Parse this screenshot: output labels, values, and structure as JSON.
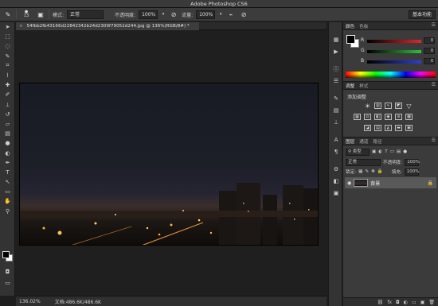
{
  "window": {
    "title": "Adobe Photoshop CS6"
  },
  "options_bar": {
    "mode_label": "模式:",
    "mode_value": "正常",
    "opacity_label": "不透明度:",
    "opacity_value": "100%",
    "flow_label": "流量:",
    "flow_value": "100%",
    "brush_size": "13",
    "workspace_label": "基本功能"
  },
  "document": {
    "tab_title": "54fbb2fb43166d22842342b24d2309f79052d244.jpg @ 136%(RGB/8#) *",
    "close_glyph": "×"
  },
  "status_bar": {
    "zoom": "136.02%",
    "doc_size": "文档:486.6K/486.6K"
  },
  "tools": [
    {
      "name": "move-tool-icon",
      "glyph": "➤"
    },
    {
      "name": "marquee-tool-icon",
      "glyph": "⬚"
    },
    {
      "name": "lasso-tool-icon",
      "glyph": "◌"
    },
    {
      "name": "quick-select-tool-icon",
      "glyph": "✎"
    },
    {
      "name": "crop-tool-icon",
      "glyph": "⌗"
    },
    {
      "name": "eyedropper-tool-icon",
      "glyph": "⌇"
    },
    {
      "name": "healing-brush-tool-icon",
      "glyph": "✚"
    },
    {
      "name": "brush-tool-icon",
      "glyph": "✐"
    },
    {
      "name": "clone-stamp-tool-icon",
      "glyph": "⊥"
    },
    {
      "name": "history-brush-tool-icon",
      "glyph": "↺"
    },
    {
      "name": "eraser-tool-icon",
      "glyph": "▱"
    },
    {
      "name": "gradient-tool-icon",
      "glyph": "▤"
    },
    {
      "name": "blur-tool-icon",
      "glyph": "●"
    },
    {
      "name": "dodge-tool-icon",
      "glyph": "◐"
    },
    {
      "name": "pen-tool-icon",
      "glyph": "✒"
    },
    {
      "name": "type-tool-icon",
      "glyph": "T"
    },
    {
      "name": "path-select-tool-icon",
      "glyph": "↖"
    },
    {
      "name": "shape-tool-icon",
      "glyph": "▭"
    },
    {
      "name": "hand-tool-icon",
      "glyph": "✋"
    },
    {
      "name": "zoom-tool-icon",
      "glyph": "⚲"
    }
  ],
  "color_panel": {
    "tabs": [
      "颜色",
      "色板"
    ],
    "r_label": "R",
    "r_value": "0",
    "g_label": "G",
    "g_value": "0",
    "b_label": "B",
    "b_value": "0",
    "colors": {
      "r_bar": "#e0262b",
      "g_bar": "#2fbf3a",
      "b_bar": "#2d3fd6"
    }
  },
  "adjustments_panel": {
    "tabs": [
      "调整",
      "样式"
    ],
    "title": "添加调整"
  },
  "layers_panel": {
    "tabs": [
      "图层",
      "通道",
      "路径"
    ],
    "filter_label": "类型",
    "blend_mode": "正常",
    "opacity_label": "不透明度:",
    "opacity_value": "100%",
    "lock_label": "锁定:",
    "fill_label": "填充:",
    "fill_value": "100%",
    "layer_name": "背景"
  }
}
